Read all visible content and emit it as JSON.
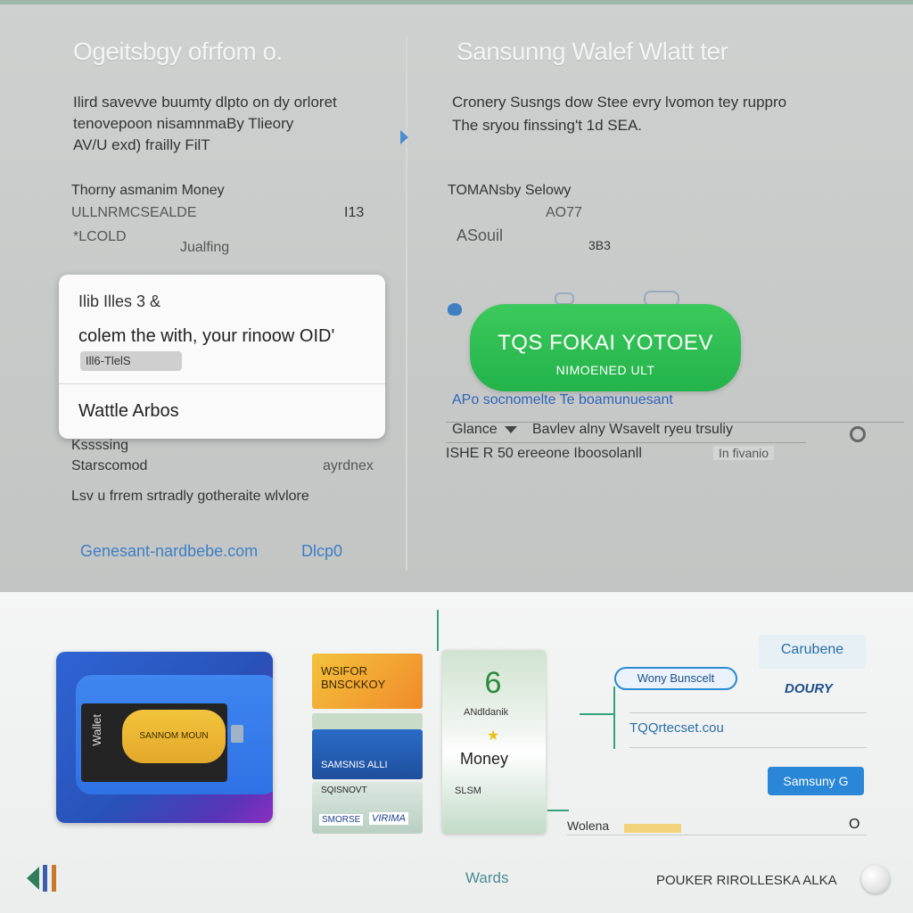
{
  "left_pane": {
    "title": "Ogeitsbgy ofrfom o.",
    "paragraph": [
      "Ilird savevve buumty dlpto on dy orloret",
      "tenovepoon nisamnmaBy Tlieory",
      "AV/U exd) frailly FilT"
    ],
    "section_title": "Thorny asmanim Money",
    "section_sub": "ULLNRMCSEALDE",
    "section_value": "I13",
    "section_code": "*LCOLD",
    "section_note": "Jualfing"
  },
  "popup": {
    "title": "Ilib Illes 3 &",
    "message": "colem the with, your rinoow OID'",
    "chip": "Ill6-TlelS",
    "option": "Wattle Arbos"
  },
  "left_lower": {
    "label1": "Kssssing",
    "label2": "Starscomod",
    "label2_right": "ayrdnex",
    "sentence": "Lsv u frrem srtradly gotheraite wlvlore",
    "link_left": "Genesant-nardbebe.com",
    "link_right": "Dlcp0"
  },
  "right_pane": {
    "title": "Sansunng Walef Wlatt ter",
    "paragraph": [
      "Cronery Susngs dow Stee evry lvomon tey ruppro",
      "The sryou finssing't 1d SEA."
    ],
    "section_title": "TOMANsby Selowy",
    "section_code": "AO77",
    "section_label": "ASouil",
    "section_value": "3B3",
    "green_button": {
      "line1": "TQS FOKAI YOTOEV",
      "line2": "NIMOENED ULT"
    },
    "row1": "APo socnomelte Te boamunuesant",
    "row2_left": "Glance",
    "row2_middle": "Bavlev alny Wsavelt ryeu trsuliy",
    "row3_left": "ISHE R",
    "row3_middle": "50 ereeone Iboosolanll",
    "row3_right": "In fivanio"
  },
  "bottom": {
    "big_card_label": "SANNOM MOUN",
    "big_card_side": "Wallet",
    "mini1": "WSIFOR BNSCKKOY",
    "mini2": "",
    "mini3": "SAMSNIS ALLI",
    "mini4_top": "SQISNOVT",
    "mini4_logo1": "SMORSE",
    "mini4_logo2": "VIRIMA",
    "phone_num": "6",
    "phone_text1": "ANdldanik",
    "phone_text2": "Money",
    "phone_text3": "SLSM",
    "right_box": "Carubene",
    "pill": "Wony Bunscelt",
    "logo": "DOURY",
    "url": "TQQrtecset.cou",
    "button": "Samsuny G",
    "bottom_note": "Wolena",
    "bottom_o": "O",
    "nav_center": "Wards",
    "footer": "POUKER RIROLLESKA ALKA"
  },
  "colors": {
    "accent_green": "#27b74d",
    "link_blue": "#3d7fc4",
    "button_blue": "#2a86d6"
  }
}
